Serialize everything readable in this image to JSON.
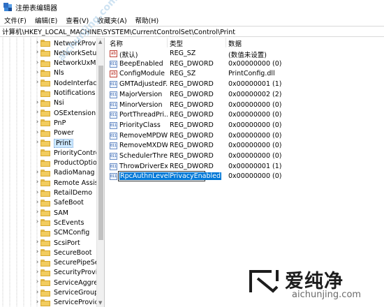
{
  "window": {
    "title": "注册表编辑器"
  },
  "menu": [
    "文件(F)",
    "编辑(E)",
    "查看(V)",
    "收藏夹(A)",
    "帮助(H)"
  ],
  "address": "计算机\\HKEY_LOCAL_MACHINE\\SYSTEM\\CurrentControlSet\\Control\\Print",
  "tree": {
    "items": [
      {
        "label": "NetworkProv",
        "expandable": true
      },
      {
        "label": "NetworkSetu",
        "expandable": true
      },
      {
        "label": "NetworkUxM",
        "expandable": true
      },
      {
        "label": "Nls",
        "expandable": true
      },
      {
        "label": "NodeInterfac",
        "expandable": true
      },
      {
        "label": "Notifications",
        "expandable": false
      },
      {
        "label": "Nsi",
        "expandable": true
      },
      {
        "label": "OSExtensionI",
        "expandable": true
      },
      {
        "label": "PnP",
        "expandable": true
      },
      {
        "label": "Power",
        "expandable": true
      },
      {
        "label": "Print",
        "expandable": true,
        "selected": true
      },
      {
        "label": "PriorityContro",
        "expandable": false
      },
      {
        "label": "ProductOptio",
        "expandable": false
      },
      {
        "label": "RadioManag",
        "expandable": true
      },
      {
        "label": "Remote Assis",
        "expandable": true
      },
      {
        "label": "RetailDemo",
        "expandable": true
      },
      {
        "label": "SafeBoot",
        "expandable": true
      },
      {
        "label": "SAM",
        "expandable": true
      },
      {
        "label": "ScEvents",
        "expandable": true
      },
      {
        "label": "SCMConfig",
        "expandable": false
      },
      {
        "label": "ScsiPort",
        "expandable": true
      },
      {
        "label": "SecureBoot",
        "expandable": true
      },
      {
        "label": "SecurePipeSe",
        "expandable": true
      },
      {
        "label": "SecurityProvi",
        "expandable": true
      },
      {
        "label": "ServiceAggre",
        "expandable": true
      },
      {
        "label": "ServiceGroup",
        "expandable": true
      },
      {
        "label": "ServiceProvic",
        "expandable": true
      }
    ]
  },
  "list": {
    "headers": {
      "name": "名称",
      "type": "类型",
      "data": "数据"
    },
    "rows": [
      {
        "name": "(默认)",
        "type": "REG_SZ",
        "data": "(数值未设置)",
        "icon": "ab"
      },
      {
        "name": "BeepEnabled",
        "type": "REG_DWORD",
        "data": "0x00000000 (0)",
        "icon": "dword"
      },
      {
        "name": "ConfigModule",
        "type": "REG_SZ",
        "data": "PrintConfig.dll",
        "icon": "ab"
      },
      {
        "name": "GMTAdjustedF...",
        "type": "REG_DWORD",
        "data": "0x00000001 (1)",
        "icon": "dword"
      },
      {
        "name": "MajorVersion",
        "type": "REG_DWORD",
        "data": "0x00000002 (2)",
        "icon": "dword"
      },
      {
        "name": "MinorVersion",
        "type": "REG_DWORD",
        "data": "0x00000000 (0)",
        "icon": "dword"
      },
      {
        "name": "PortThreadPri...",
        "type": "REG_DWORD",
        "data": "0x00000000 (0)",
        "icon": "dword"
      },
      {
        "name": "PriorityClass",
        "type": "REG_DWORD",
        "data": "0x00000000 (0)",
        "icon": "dword"
      },
      {
        "name": "RemoveMPDW",
        "type": "REG_DWORD",
        "data": "0x00000000 (0)",
        "icon": "dword"
      },
      {
        "name": "RemoveMXDW",
        "type": "REG_DWORD",
        "data": "0x00000000 (0)",
        "icon": "dword"
      },
      {
        "name": "SchedulerThre...",
        "type": "REG_DWORD",
        "data": "0x00000000 (0)",
        "icon": "dword"
      },
      {
        "name": "ThrowDriverEx...",
        "type": "REG_DWORD",
        "data": "0x00000001 (1)",
        "icon": "dword"
      },
      {
        "name": "RpcAuthnLevelPrivacyEnabled",
        "type": "",
        "data": "0x00000000 (0)",
        "icon": "dword",
        "editing": true
      }
    ]
  },
  "watermark": {
    "brand": "爱纯净",
    "url": "aichunjing.com",
    "diagonal": "aichunjing.com"
  }
}
